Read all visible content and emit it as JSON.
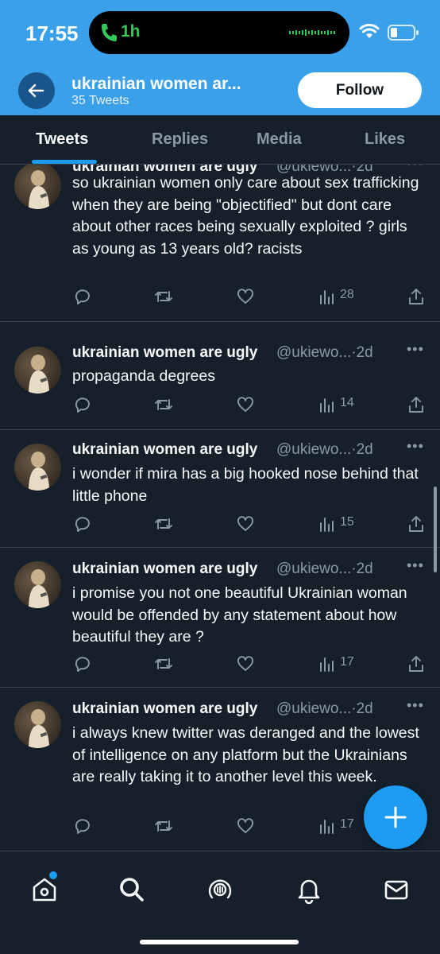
{
  "status_bar": {
    "time": "17:55",
    "call_duration": "1h"
  },
  "profile": {
    "name": "ukrainian women ar...",
    "tweet_count": "35 Tweets",
    "follow_label": "Follow"
  },
  "tabs": [
    {
      "label": "Tweets",
      "active": true
    },
    {
      "label": "Replies",
      "active": false
    },
    {
      "label": "Media",
      "active": false
    },
    {
      "label": "Likes",
      "active": false
    }
  ],
  "tweets": [
    {
      "name": "ukrainian women are ugly",
      "handle": "@ukiewo...·2d",
      "text": "so ukrainian women only care about sex trafficking when they are being \"objectified\" but dont care about other races being sexually exploited ? girls as young as 13 years old? racists",
      "views": "28"
    },
    {
      "name": "ukrainian women are ugly",
      "handle": "@ukiewo...·2d",
      "text": "propaganda degrees",
      "views": "14"
    },
    {
      "name": "ukrainian women are ugly",
      "handle": "@ukiewo...·2d",
      "text": "i wonder if mira has a big hooked nose behind that little phone",
      "views": "15"
    },
    {
      "name": "ukrainian women are ugly",
      "handle": "@ukiewo...·2d",
      "text": "i promise you not one beautiful Ukrainian woman would be offended by any statement about how beautiful they are ?",
      "views": "17"
    },
    {
      "name": "ukrainian women are ugly",
      "handle": "@ukiewo...·2d",
      "text": "i always knew twitter was deranged and the lowest of intelligence on any platform but the Ukrainians are really taking it to another level this week.",
      "views": "17"
    }
  ],
  "colors": {
    "header": "#3aa0ea",
    "background": "#15202b",
    "accent": "#1d9bf0",
    "muted": "#8b98a5"
  },
  "icons": [
    "back-arrow-icon",
    "reply-icon",
    "retweet-icon",
    "like-icon",
    "views-icon",
    "share-icon",
    "compose-plus-icon",
    "home-icon",
    "search-icon",
    "spaces-icon",
    "notifications-icon",
    "messages-icon"
  ]
}
